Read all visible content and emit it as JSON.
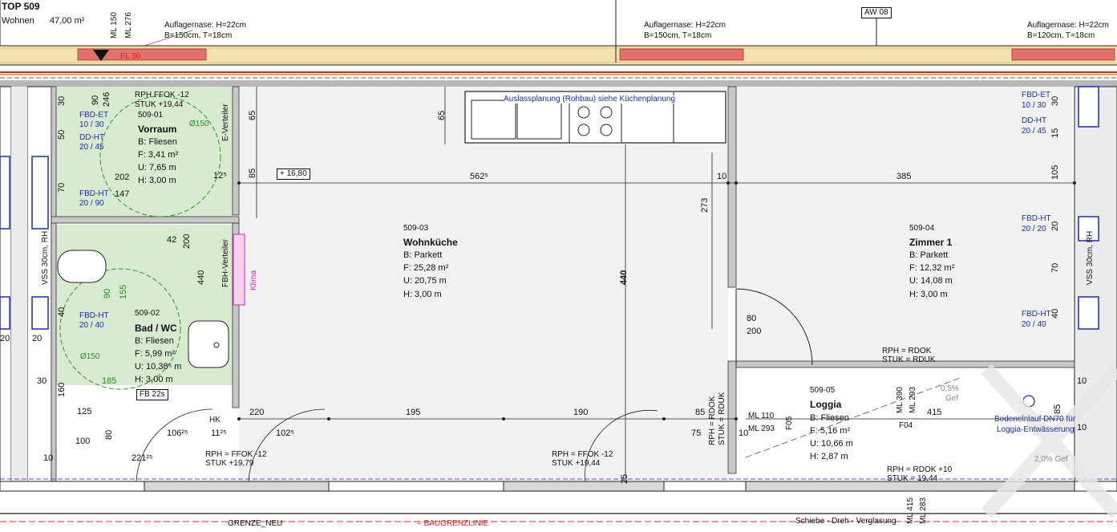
{
  "unit": {
    "title": "TOP 509",
    "type": "Wohnen",
    "area": "47,00 m²"
  },
  "top_labels": {
    "auflager": [
      {
        "line1": "Auflagernase: H=22cm",
        "line2": "B=150cm, T=18cm"
      },
      {
        "line1": "Auflagernase: H=22cm",
        "line2": "B=150cm, T=18cm"
      },
      {
        "line1": "Auflagernase: H=22cm",
        "line2": "B=120cm, T=18cm"
      }
    ],
    "aw": "AW 08",
    "ml150": "ML 150",
    "ml276": "ML 276",
    "fl30": "FL 30"
  },
  "rooms": {
    "vorraum": {
      "id": "509-01",
      "name": "Vorraum",
      "b": "B: Fliesen",
      "f": "F: 3,41 m²",
      "u": "U: 7,65 m",
      "h": "H: 3,00 m",
      "rph": "RPH FFOK -12",
      "stuk": "STUK +19,44"
    },
    "bad": {
      "id": "509-02",
      "name": "Bad / WC",
      "b": "B: Fliesen",
      "f": "F: 5,99 m²",
      "u": "U: 10,38⁵ m",
      "h": "H: 3,00 m"
    },
    "wohnkueche": {
      "id": "509-03",
      "name": "Wohnküche",
      "b": "B: Parkett",
      "f": "F: 25,28 m²",
      "u": "U: 20,75 m",
      "h": "H: 3,00 m"
    },
    "zimmer": {
      "id": "509-04",
      "name": "Zimmer 1",
      "b": "B: Parkett",
      "f": "F: 12,32 m²",
      "u": "U: 14,08 m",
      "h": "H: 3,00 m"
    },
    "loggia": {
      "id": "509-05",
      "name": "Loggia",
      "b": "B: Fliesen",
      "f": "F: 5,16 m²",
      "u": "U: 10,66 m",
      "h": "H: 2,87 m"
    }
  },
  "fbd": {
    "et_left": {
      "l1": "FBD-ET",
      "l2": "10 / 30"
    },
    "dd_left": {
      "l1": "DD-HT",
      "l2": "20 / 45"
    },
    "ht_left1": {
      "l1": "FBD-HT",
      "l2": "20 / 90"
    },
    "ht_left2": {
      "l1": "FBD-HT",
      "l2": "20 / 40"
    },
    "et_right": {
      "l1": "FBD-ET",
      "l2": "10 / 30"
    },
    "dd_right": {
      "l1": "DD-HT",
      "l2": "20 / 45"
    },
    "ht_right1": {
      "l1": "FBD-HT",
      "l2": "20 / 20"
    },
    "ht_right2": {
      "l1": "FBD-HT",
      "l2": "20 / 40"
    }
  },
  "kitchen_note": "Auslassplanung (Rohbau) siehe Küchenplanung",
  "level_box": "+ 16,80",
  "labels": {
    "e_verteiler": "E-Verteiler",
    "fbh_verteiler": "FBH-Verteiler",
    "klima": "Klima",
    "fb22s": "FB 22s",
    "hk": "HK",
    "rph_rdok_1": "RPH = RDOK",
    "stuk_rduk": "STUK = RDUK",
    "rph_rdok_v": "RPH = RDOK",
    "stuk_rduk_v": "STUK = RDUK",
    "ml110": "ML 110",
    "ml293": "ML 293",
    "f05": "F05",
    "f04": "F04",
    "ml390": "ML 390",
    "ml293b": "ML 293",
    "gef": "0,5%",
    "gef2": "Gef",
    "drain1": "Bodenelnlauf DN70 für",
    "drain2": "Loggia-Entwässerung",
    "gef3": "2,0% Gef",
    "rph_ffok_bottom": "RPH = FFOK -12",
    "stuk_bottom": "STUK +19,44",
    "rph_ffok_left": "RPH = FFOK -12",
    "stuk_left": "STUK +19,79",
    "rph_rdok_10": "RPH = RDOK +10",
    "stuk_1944": "STUK = 19,44",
    "schiebe": "Schiebe - Dreh - Verglasung",
    "grenze": "GRENZE_NEU",
    "baugrenze": "= BAUGRENZLINIE",
    "ml415": "ML 415",
    "ml283": "ML 283",
    "vss_left": "VSS 30cm, RH",
    "vss_right": "VSS 30cm, RH",
    "diam150a": "Ø150",
    "diam150b": "Ø150"
  },
  "dims": {
    "d5625": "562⁵",
    "d10": "10",
    "d385": "385",
    "d195": "195",
    "d190": "190",
    "d85a": "85",
    "d220": "220",
    "d415": "415",
    "d10b": "10",
    "d440a": "440",
    "d440b": "440",
    "d273": "273",
    "d65a": "65",
    "d65b": "65",
    "d85b": "85",
    "d80": "80",
    "d200a": "200",
    "d200b": "200",
    "d202": "202",
    "d147": "147",
    "d125": "125",
    "d12": "12⁵",
    "d185": "185",
    "d155": "155",
    "d90a": "90",
    "d90b": "90",
    "d246": "246",
    "d30a": "30",
    "d50": "50",
    "d70a": "70",
    "d40a": "40",
    "d160": "160",
    "d30b": "30",
    "d20a": "20",
    "d20b": "20",
    "d125b": "125",
    "d100": "100",
    "d80b": "80",
    "d10625": "106²⁵",
    "d1125": "11²⁵",
    "d1025": "102⁵",
    "d22125": "221²⁵",
    "d10c": "10",
    "d75": "75",
    "d10d": "10",
    "d85c": "85",
    "d25": "25",
    "d42": "42",
    "r30": "30",
    "r15": "15",
    "r105": "105",
    "r20": "20",
    "r70": "70",
    "r40": "40",
    "r10": "10",
    "r85": "85",
    "r10b": "10"
  }
}
